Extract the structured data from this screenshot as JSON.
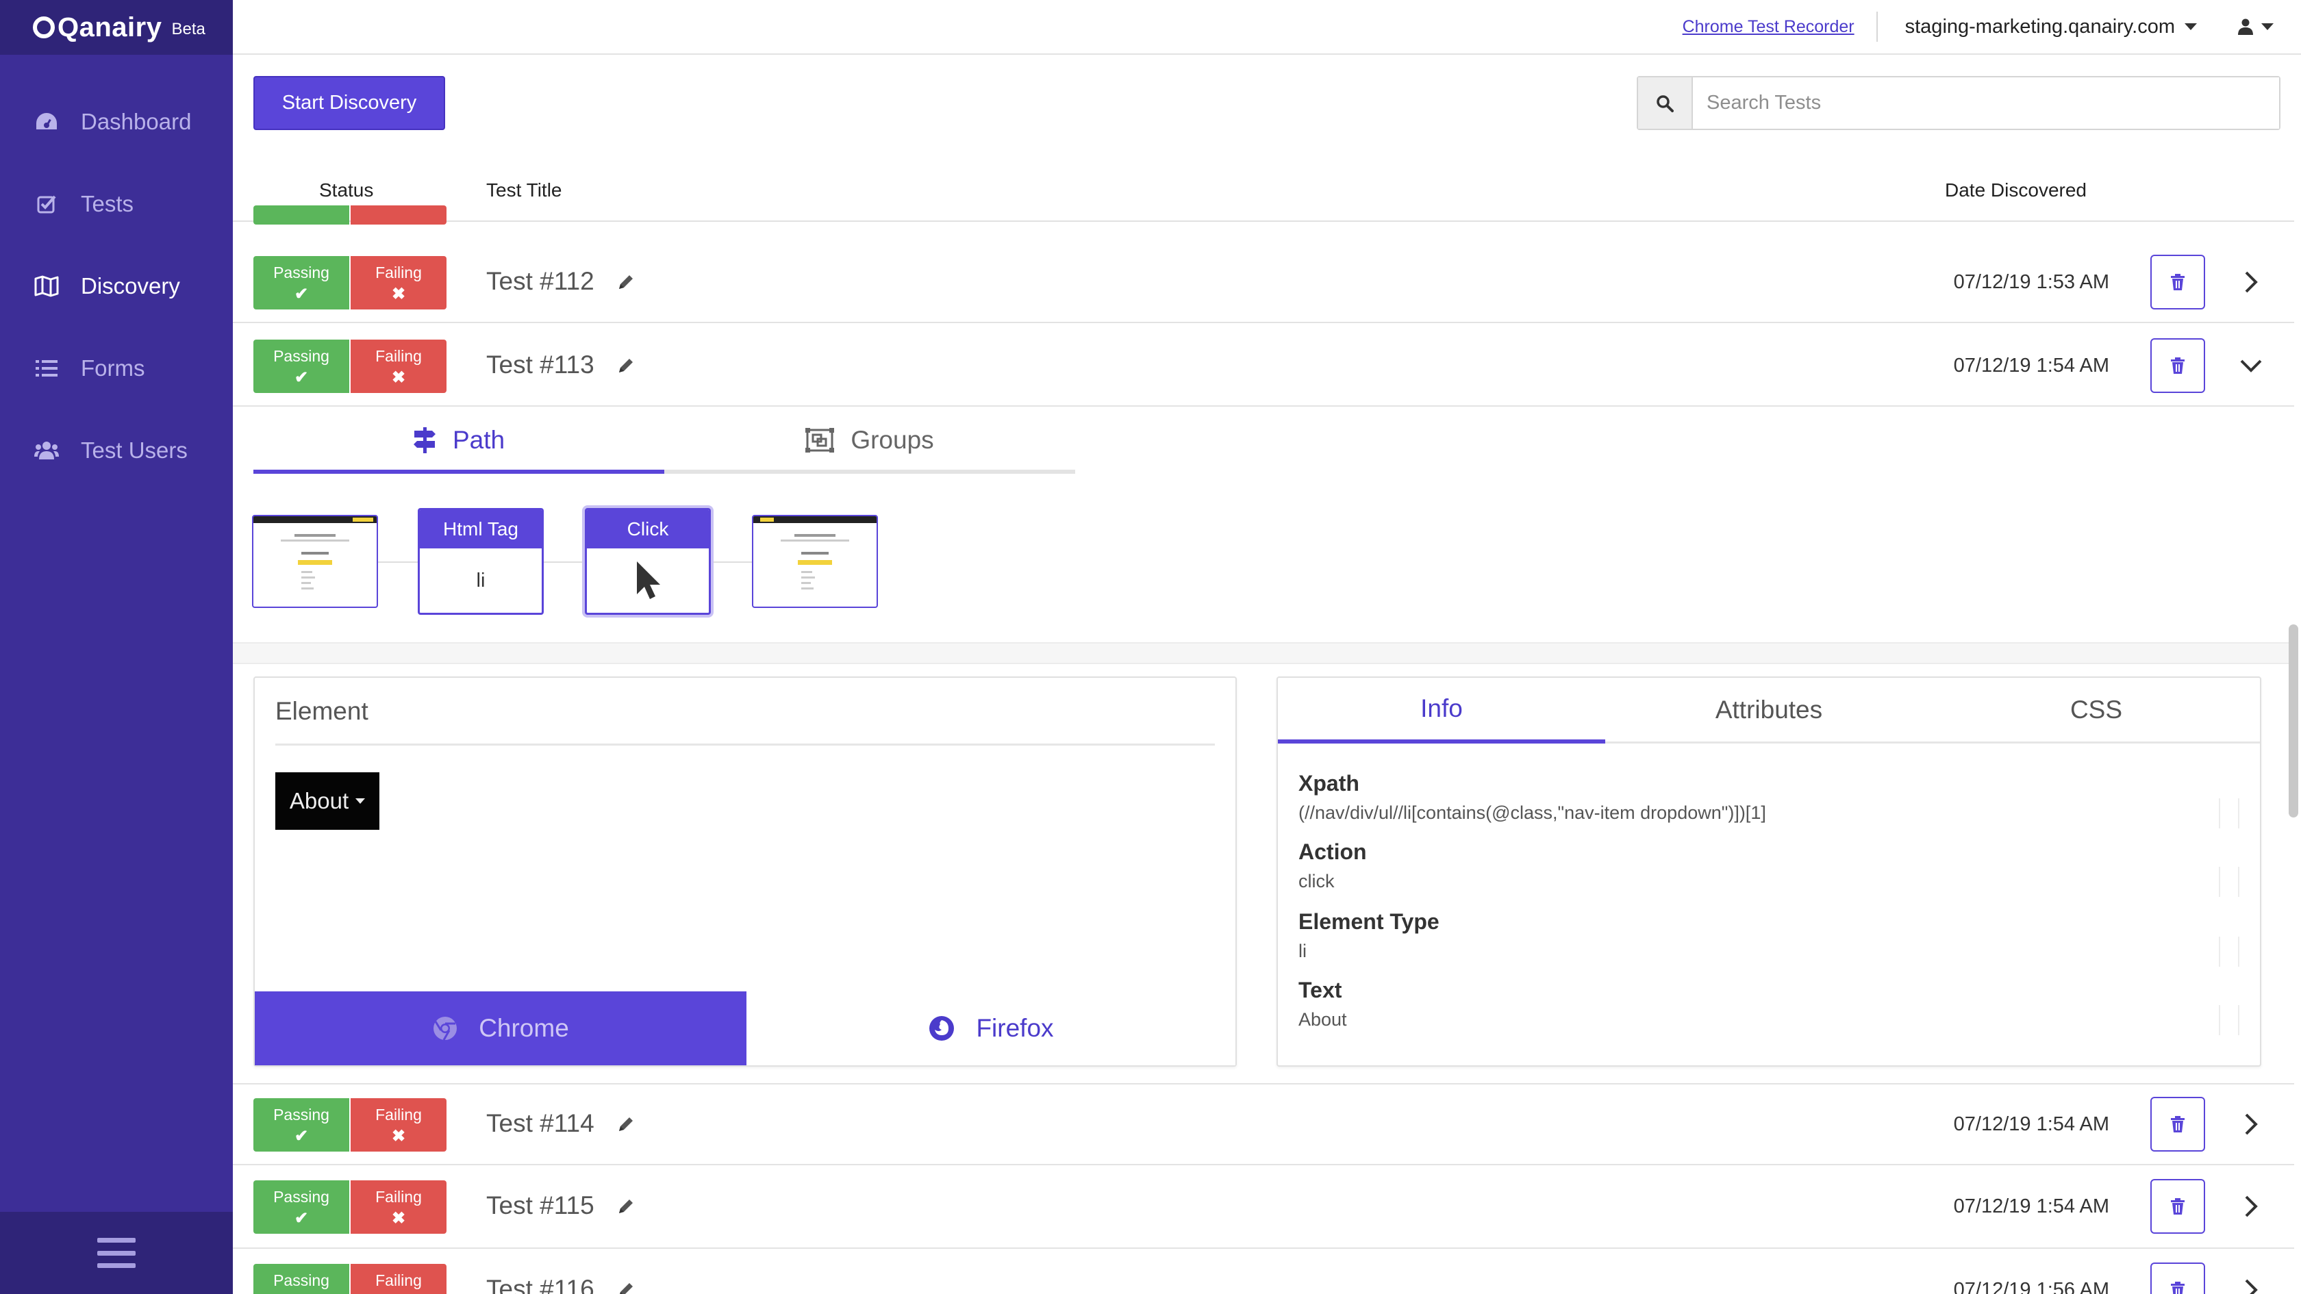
{
  "app": {
    "logo": "Qanairy",
    "beta": "Beta"
  },
  "sidebar": {
    "items": [
      {
        "label": "Dashboard",
        "icon": "dashboard-icon"
      },
      {
        "label": "Tests",
        "icon": "check-square-icon"
      },
      {
        "label": "Discovery",
        "icon": "map-icon",
        "active": true
      },
      {
        "label": "Forms",
        "icon": "list-icon"
      },
      {
        "label": "Test Users",
        "icon": "users-icon"
      }
    ]
  },
  "topbar": {
    "recorder_link": "Chrome Test Recorder",
    "domain": "staging-marketing.qanairy.com"
  },
  "toolbar": {
    "start_label": "Start Discovery",
    "search_placeholder": "Search Tests",
    "search_value": ""
  },
  "table": {
    "headers": {
      "status": "Status",
      "title": "Test Title",
      "date": "Date Discovered"
    },
    "badges": {
      "passing": "Passing",
      "failing": "Failing"
    },
    "rows": [
      {
        "title": "Test #112",
        "date": "07/12/19 1:53 AM",
        "expanded": false
      },
      {
        "title": "Test #113",
        "date": "07/12/19 1:54 AM",
        "expanded": true
      },
      {
        "title": "Test #114",
        "date": "07/12/19 1:54 AM",
        "expanded": false
      },
      {
        "title": "Test #115",
        "date": "07/12/19 1:54 AM",
        "expanded": false
      },
      {
        "title": "Test #116",
        "date": "07/12/19 1:56 AM",
        "expanded": false
      }
    ]
  },
  "expanded": {
    "tabs": {
      "path": "Path",
      "groups": "Groups",
      "active": "Path"
    },
    "steps": [
      {
        "type": "page-thumbnail"
      },
      {
        "header": "Html Tag",
        "body": "li"
      },
      {
        "header": "Click",
        "body": "cursor",
        "selected": true
      },
      {
        "type": "page-thumbnail"
      }
    ],
    "element_panel": {
      "title": "Element",
      "preview_text": "About",
      "browsers": {
        "chrome": "Chrome",
        "firefox": "Firefox",
        "active": "Chrome"
      }
    },
    "info_panel": {
      "tabs": [
        "Info",
        "Attributes",
        "CSS"
      ],
      "active_tab": "Info",
      "fields": [
        {
          "label": "Xpath",
          "value": "(//nav/div/ul//li[contains(@class,\"nav-item dropdown\")])[1]"
        },
        {
          "label": "Action",
          "value": "click"
        },
        {
          "label": "Element Type",
          "value": "li"
        },
        {
          "label": "Text",
          "value": "About"
        }
      ]
    }
  },
  "colors": {
    "sidebar": "#3d2e97",
    "accent": "#5a45d9",
    "passing": "#5bb65b",
    "failing": "#df534f"
  }
}
